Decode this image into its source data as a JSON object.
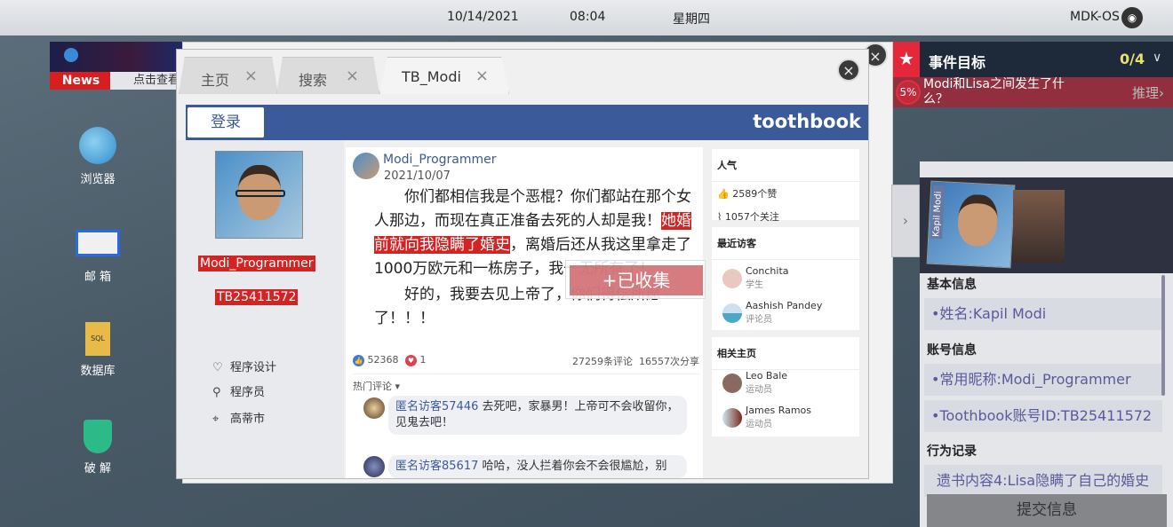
{
  "topbar": {
    "date": "10/14/2021",
    "time": "08:04",
    "weekday": "星期四",
    "os_name": "MDK-OS"
  },
  "news": {
    "label": "News",
    "text": "点击查看"
  },
  "desktop": [
    {
      "label": "浏览器",
      "icon": "globe-icon"
    },
    {
      "label": "邮 箱",
      "icon": "mail-icon"
    },
    {
      "label": "数据库",
      "icon": "sql-file-icon"
    },
    {
      "label": "破 解",
      "icon": "shield-key-icon"
    }
  ],
  "browser": {
    "tabs": [
      {
        "label": "主页"
      },
      {
        "label": "搜索"
      },
      {
        "label": "TB_Modi"
      }
    ],
    "close_symbol": "×",
    "login": "登录",
    "brand": "toothbook",
    "profile": {
      "name": "Modi_Programmer",
      "id": "TB25411572",
      "interest": "程序设计",
      "job": "程序员",
      "city": "高蒂市"
    },
    "post": {
      "author": "Modi_Programmer",
      "date": "2021/10/07",
      "p1a": "你们都相信我是个恶棍？你们都站在那个女人那边，而现在真正准备去死的人却是我！",
      "p1hl": "她婚前就向我隐瞒了婚史",
      "p1b": "，离婚后还从我这里拿走了1000万欧元和一栋房子，我一无所有了！",
      "p2": "好的，我要去见上帝了，你们得偿所愿了！！！",
      "likes": "52368",
      "hearts": "1",
      "comments": "27259条评论",
      "shares": "16557次分享",
      "hot": "热门评论 ▾",
      "comment_list": [
        {
          "user": "匿名访客57446",
          "text": "去死吧，家暴男！上帝可不会收留你，见鬼去吧！"
        },
        {
          "user": "匿名访客85617",
          "text": "哈哈，没人拦着你会不会很尴尬，别"
        }
      ]
    },
    "toast": "+已收集",
    "sidebar": {
      "pop_title": "人气",
      "likes": "2589个赞",
      "follows": "1057个关注",
      "visitors_title": "最近访客",
      "visitors": [
        {
          "name": "Conchita",
          "role": "学生"
        },
        {
          "name": "Aashish Pandey",
          "role": "评论员"
        }
      ],
      "related_title": "相关主页",
      "related": [
        {
          "name": "Leo Bale",
          "role": "运动员"
        },
        {
          "name": "James Ramos",
          "role": "运动员"
        }
      ]
    }
  },
  "goal": {
    "title": "事件目标",
    "count": "0/4",
    "progress": "5%",
    "question": "Modi和Lisa之间发生了什么？",
    "reason": "推理›"
  },
  "character": {
    "card_name": "Kapil Modi",
    "sec1": "基本信息",
    "name": "•姓名:Kapil Modi",
    "sec2": "账号信息",
    "nick": "•常用昵称:Modi_Programmer",
    "tbid": "•Toothbook账号ID:TB25411572",
    "sec3": "行为记录",
    "record": "遗书内容4:Lisa隐瞒了自己的婚史",
    "submit": "提交信息"
  },
  "colors": {
    "brand_blue": "#3b5a9a",
    "highlight_red": "#d32424",
    "goal_red": "#e4283a"
  }
}
